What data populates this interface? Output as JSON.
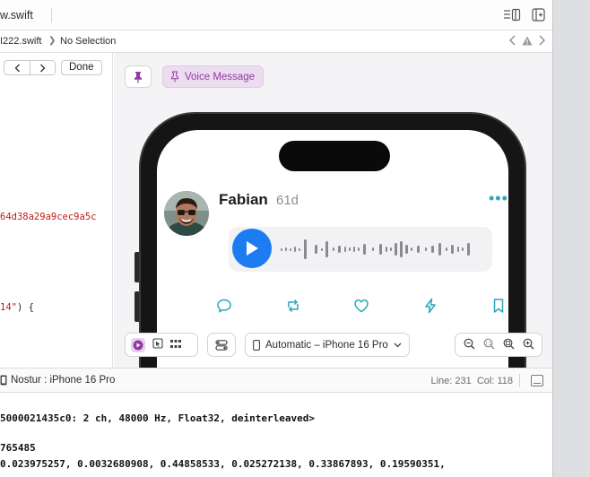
{
  "tabbar": {
    "file_tab": "w.swift"
  },
  "jumpbar": {
    "file": "I222.swift",
    "separator": "❯",
    "selection": "No Selection"
  },
  "editor": {
    "done_label": "Done",
    "hash_text": "64d38a29a9cec9a5c",
    "brace_line": {
      "string": "14\"",
      "rest": ") {"
    }
  },
  "canvas": {
    "voice_message_label": "Voice Message",
    "post": {
      "name": "Fabian",
      "time": "61d"
    },
    "device_label": "Automatic – iPhone 16 Pro",
    "accent": "#2aa8b6",
    "play_color": "#1e7cf2",
    "pin_color": "#8f3aa3"
  },
  "debugbar": {
    "scheme": "Nostur : iPhone 16 Pro",
    "line_label": "Line: 231",
    "col_label": "Col: 118"
  },
  "console": {
    "lines": [
      "5000021435c0:  2 ch,  48000 Hz, Float32, deinterleaved>",
      "765485",
      " 0.023975257, 0.0032680908, 0.44858533, 0.025272138, 0.33867893, 0.19590351,"
    ]
  }
}
